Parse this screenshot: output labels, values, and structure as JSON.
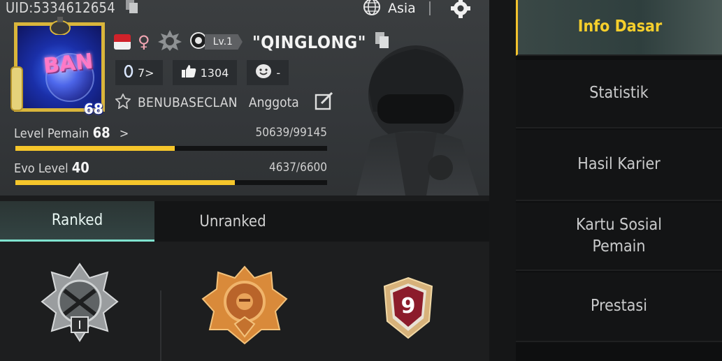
{
  "profile": {
    "uid": "UID:5334612654",
    "region": "Asia",
    "avatar_text": "BAN",
    "avatar_level": "68",
    "level_badge": "Lv.1",
    "nickname": "\"QINGLONG\"",
    "stats": {
      "popularity": "7>",
      "likes": "1304",
      "mood": "-"
    },
    "clan": {
      "name": "BENUBASECLAN",
      "role": "Anggota"
    },
    "player_level": {
      "label": "Level Pemain",
      "value": "68",
      "arrow": ">",
      "xp": "50639/99145",
      "progress": 0.511
    },
    "evo_level": {
      "label": "Evo Level",
      "value": "40",
      "xp": "4637/6600",
      "progress": 0.703
    }
  },
  "tabs": [
    {
      "label": "Ranked",
      "active": true
    },
    {
      "label": "Unranked",
      "active": false
    }
  ],
  "badges": {
    "third_number": "9"
  },
  "menu": [
    {
      "label": "Info Dasar",
      "active": true
    },
    {
      "label": "Statistik",
      "active": false
    },
    {
      "label": "Hasil Karier",
      "active": false
    },
    {
      "label": "Kartu Sosial Pemain",
      "active": false
    },
    {
      "label": "Prestasi",
      "active": false
    }
  ],
  "colors": {
    "accent_yellow": "#f6c62b",
    "tab_accent": "#7fe3cf",
    "menu_active_text": "#f6cf2c"
  },
  "icons": {
    "uid_copy": "copy-icon",
    "region": "globe-icon",
    "settings": "gear-icon",
    "flag": "indonesia-flag-icon",
    "gender": "female-icon",
    "rank_emblem": "rank-emblem-icon",
    "popularity": "popularity-icon",
    "likes": "thumbs-up-icon",
    "mood": "smile-icon",
    "clan": "clan-emblem-icon",
    "edit": "edit-icon",
    "nickname_copy": "copy-icon"
  }
}
